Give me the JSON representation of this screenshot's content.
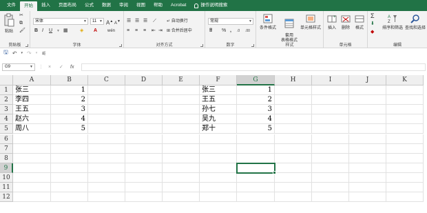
{
  "tabs": [
    "文件",
    "开始",
    "插入",
    "页面布局",
    "公式",
    "数据",
    "审阅",
    "视图",
    "帮助",
    "Acrobat"
  ],
  "active_tab_index": 1,
  "tell_me": "操作说明搜索",
  "ribbon": {
    "clipboard": {
      "label": "剪贴板",
      "paste": "粘贴"
    },
    "font": {
      "label": "字体",
      "font_name": "宋体",
      "font_size": "11",
      "bold": "B",
      "italic": "I",
      "underline": "U",
      "grow": "A",
      "shrink": "A",
      "font_color_glyph": "A",
      "phonetic": "wén"
    },
    "alignment": {
      "label": "对齐方式",
      "wrap": "自动换行",
      "merge": "合并后居中"
    },
    "number": {
      "label": "数字",
      "format": "常规",
      "percent": "%",
      "comma": ","
    },
    "styles": {
      "label": "样式",
      "conditional": "条件格式",
      "table": "套用\n表格格式",
      "cell_styles": "单元格样式"
    },
    "cells": {
      "label": "单元格",
      "insert": "插入",
      "delete": "删除",
      "format": "格式"
    },
    "editing": {
      "label": "编辑",
      "sort": "排序和筛选",
      "find": "查找和选择",
      "sum": "Σ"
    }
  },
  "namebox": "G9",
  "formula_buttons": {
    "cancel": "×",
    "enter": "✓",
    "fx": "fx"
  },
  "formula_value": "",
  "columns": [
    "A",
    "B",
    "C",
    "D",
    "E",
    "F",
    "G",
    "H",
    "I",
    "J",
    "K"
  ],
  "rows": [
    "1",
    "2",
    "3",
    "4",
    "5",
    "6",
    "7",
    "8",
    "9",
    "10",
    "11",
    "12"
  ],
  "selected_column": "G",
  "selected_row": "9",
  "cells": {
    "A1": "张三",
    "B1": "1",
    "A2": "李四",
    "B2": "2",
    "A3": "王五",
    "B3": "3",
    "A4": "赵六",
    "B4": "4",
    "A5": "周八",
    "B5": "5",
    "F1": "张三",
    "G1": "1",
    "F2": "王五",
    "G2": "2",
    "F3": "孙七",
    "G3": "3",
    "F4": "吴九",
    "G4": "4",
    "F5": "郑十",
    "G5": "5"
  },
  "colors": {
    "accent": "#217346",
    "header_bg": "#efefef",
    "selected_header": "#d2d2d2"
  }
}
